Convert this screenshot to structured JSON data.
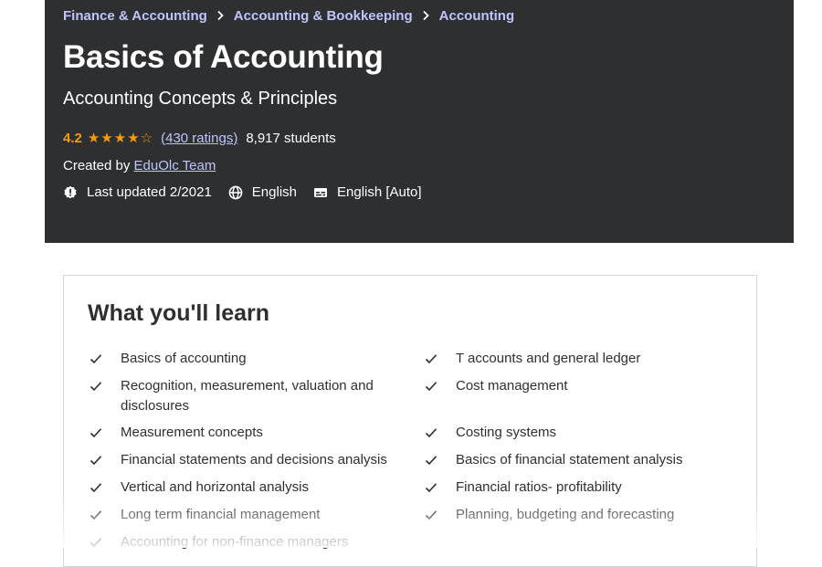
{
  "breadcrumb": [
    "Finance & Accounting",
    "Accounting & Bookkeeping",
    "Accounting"
  ],
  "course": {
    "title": "Basics of Accounting",
    "subtitle": "Accounting Concepts & Principles",
    "rating": "4.2",
    "stars": "★★★★☆",
    "rating_count": "(430 ratings)",
    "students": "8,917 students",
    "created_prefix": "Created by",
    "author": "EduOlc Team",
    "last_updated": "Last updated 2/2021",
    "language": "English",
    "captions": "English [Auto]"
  },
  "learn": {
    "heading": "What you'll learn",
    "left": [
      "Basics of accounting",
      "Recognition, measurement, valuation and disclosures",
      "Measurement concepts",
      "Financial statements and decisions analysis",
      "Vertical and horizontal analysis",
      "Long term financial management",
      "Accounting for non-finance managers"
    ],
    "right": [
      "T accounts and general ledger",
      "Cost management",
      "Costing systems",
      "Basics of financial statement analysis",
      "Financial ratios- profitability",
      "Planning, budgeting and forecasting"
    ]
  },
  "colors": {
    "hero_bg": "#2d2f31",
    "link": "#c0c4fc",
    "star": "#f69c08",
    "text": "#2d2f31"
  },
  "icons": [
    "chevron-right-icon",
    "alert-badge-icon",
    "globe-icon",
    "captions-icon",
    "check-icon"
  ]
}
